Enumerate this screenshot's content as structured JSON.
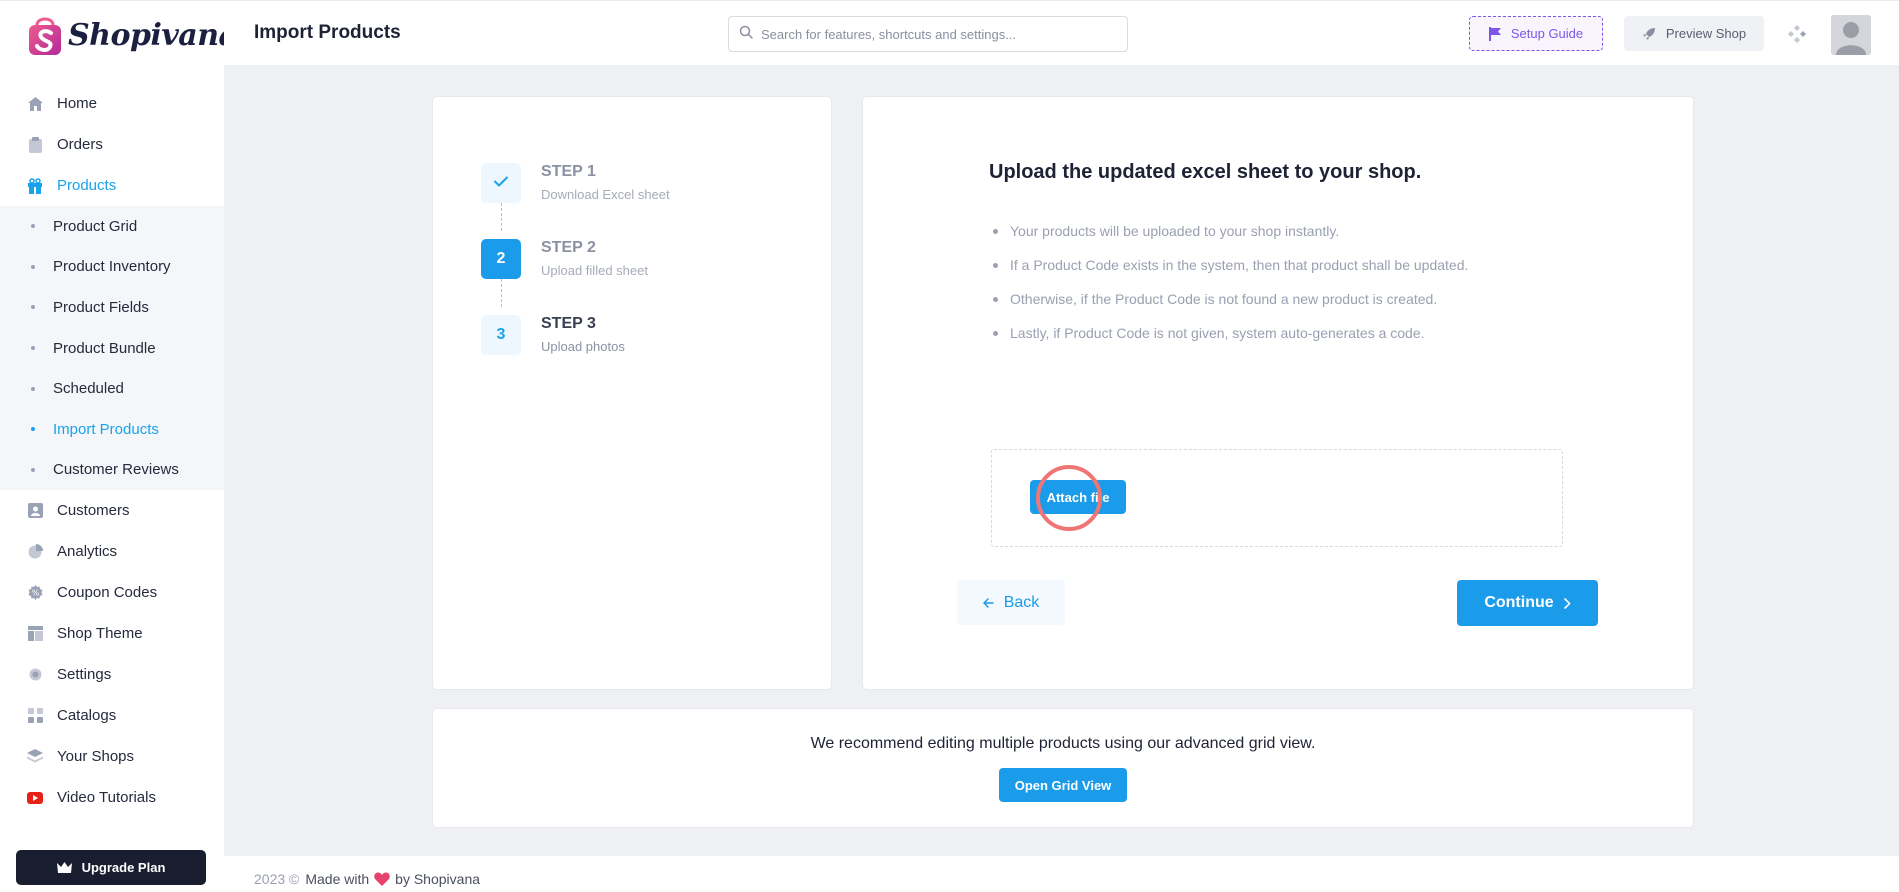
{
  "brand": {
    "name": "Shopivana"
  },
  "header": {
    "title": "Import Products",
    "search_placeholder": "Search for features, shortcuts and settings...",
    "setup_guide": "Setup Guide",
    "preview_shop": "Preview Shop"
  },
  "sidebar": {
    "items": [
      {
        "label": "Home",
        "icon": "home-icon"
      },
      {
        "label": "Orders",
        "icon": "clipboard-icon"
      },
      {
        "label": "Products",
        "icon": "gift-icon",
        "active": true
      }
    ],
    "products_sub": [
      {
        "label": "Product Grid"
      },
      {
        "label": "Product Inventory"
      },
      {
        "label": "Product Fields"
      },
      {
        "label": "Product Bundle"
      },
      {
        "label": "Scheduled"
      },
      {
        "label": "Import Products",
        "active": true
      },
      {
        "label": "Customer Reviews"
      }
    ],
    "items_after": [
      {
        "label": "Customers",
        "icon": "user-card-icon"
      },
      {
        "label": "Analytics",
        "icon": "pie-chart-icon"
      },
      {
        "label": "Coupon Codes",
        "icon": "coupon-icon"
      },
      {
        "label": "Shop Theme",
        "icon": "layout-icon"
      },
      {
        "label": "Settings",
        "icon": "gear-icon"
      },
      {
        "label": "Catalogs",
        "icon": "catalog-icon"
      },
      {
        "label": "Your Shops",
        "icon": "layers-icon"
      },
      {
        "label": "Video Tutorials",
        "icon": "youtube-icon"
      }
    ],
    "upgrade_label": "Upgrade Plan"
  },
  "steps": [
    {
      "badge": "",
      "title": "STEP 1",
      "subtitle": "Download Excel sheet",
      "state": "done"
    },
    {
      "badge": "2",
      "title": "STEP 2",
      "subtitle": "Upload filled sheet",
      "state": "current"
    },
    {
      "badge": "3",
      "title": "STEP 3",
      "subtitle": "Upload photos",
      "state": "next"
    }
  ],
  "upload": {
    "title": "Upload the updated excel sheet to your shop.",
    "bullets": [
      "Your products will be uploaded to your shop instantly.",
      "If a Product Code exists in the system, then that product shall be updated.",
      "Otherwise, if the Product Code is not found a new product is created.",
      "Lastly, if Product Code is not given, system auto-generates a code."
    ],
    "attach_label": "Attach file",
    "back_label": "Back",
    "continue_label": "Continue"
  },
  "grid_promo": {
    "text": "We recommend editing multiple products using our advanced grid view.",
    "button": "Open Grid View"
  },
  "footer": {
    "year": "2023 ©",
    "made_with": "Made with",
    "by": "by Shopivana"
  },
  "colors": {
    "accent": "#1a9cea",
    "setup_purple": "#7d55e8",
    "dark": "#181d2f",
    "heart": "#e8436e",
    "youtube": "#e62117"
  }
}
